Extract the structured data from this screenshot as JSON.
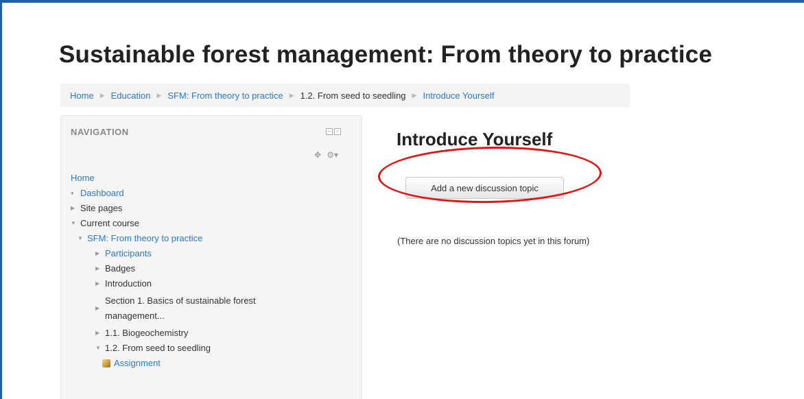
{
  "course": {
    "title": "Sustainable forest management: From theory to practice"
  },
  "breadcrumb": [
    {
      "label": "Home",
      "link": true
    },
    {
      "label": "Education",
      "link": true
    },
    {
      "label": "SFM: From theory to practice",
      "link": true
    },
    {
      "label": "1.2. From seed to seedling",
      "link": false
    },
    {
      "label": "Introduce Yourself",
      "link": true
    }
  ],
  "navigation": {
    "header": "NAVIGATION",
    "items": [
      {
        "label": "Home",
        "marker": "none",
        "link": true,
        "level": 0
      },
      {
        "label": "Dashboard",
        "marker": "bullet",
        "link": true,
        "level": 0
      },
      {
        "label": "Site pages",
        "marker": "collapsed",
        "link": false,
        "level": 0
      },
      {
        "label": "Current course",
        "marker": "expanded",
        "link": false,
        "level": 0
      },
      {
        "label": "SFM: From theory to practice",
        "marker": "expanded",
        "link": true,
        "level": 1
      },
      {
        "label": "Participants",
        "marker": "collapsed",
        "link": true,
        "level": 2
      },
      {
        "label": "Badges",
        "marker": "collapsed",
        "link": false,
        "level": 2
      },
      {
        "label": "Introduction",
        "marker": "collapsed",
        "link": false,
        "level": 2
      },
      {
        "label": "Section 1. Basics of sustainable forest management...",
        "marker": "collapsed",
        "link": false,
        "level": 2
      },
      {
        "label": "1.1. Biogeochemistry",
        "marker": "collapsed",
        "link": false,
        "level": 2
      },
      {
        "label": "1.2. From seed to seedling",
        "marker": "expanded",
        "link": false,
        "level": 2
      },
      {
        "label": "Assignment",
        "marker": "assignment",
        "link": true,
        "level": 3
      }
    ]
  },
  "forum": {
    "title": "Introduce Yourself",
    "add_button_label": "Add a new discussion topic",
    "empty_message": "(There are no discussion topics yet in this forum)"
  },
  "colors": {
    "link": "#2f79c4",
    "highlight": "#e01616",
    "frame": "#1f5fa8"
  }
}
